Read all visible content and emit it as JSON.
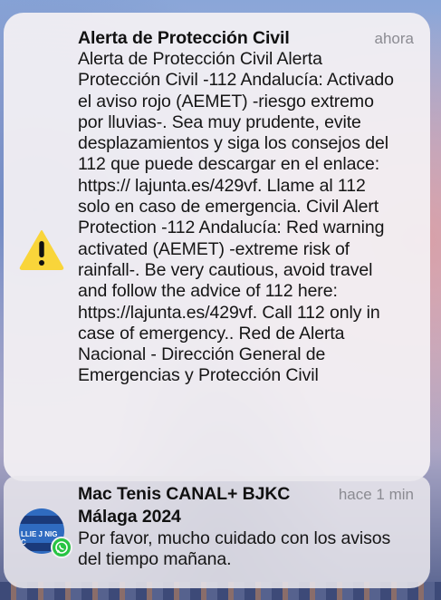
{
  "notifications": [
    {
      "title": "Alerta de Protección Civil",
      "time": "ahora",
      "icon": "warning-triangle-icon",
      "body": "Alerta de Protección Civil Alerta Protección Civil -112 Andalucía: Activado el aviso rojo (AEMET) -riesgo extremo por lluvias-. Sea muy prudente, evite desplazamientos y siga los consejos del 112 que puede descargar en el enlace: https:// lajunta.es/429vf. Llame al 112 solo en caso de emergencia. Civil Alert Protection -112 Andalucía: Red warning activated (AEMET) -extreme risk of rainfall-. Be very cautious, avoid travel and follow the advice of 112 here: https://lajunta.es/429vf. Call 112 only in case of emergency.. Red de Alerta Nacional - Dirección General de Emergencias y Protección Civil"
    },
    {
      "title": "Mac Tenis CANAL+ BJKC Málaga 2024",
      "time": "hace 1 min",
      "icon": "group-avatar-icon",
      "app_icon": "whatsapp-icon",
      "avatar_text": "LLIE J  NIG C",
      "body": "Por favor, mucho cuidado con los avisos del tiempo mañana."
    }
  ],
  "colors": {
    "warning": "#f9d53a",
    "whatsapp": "#27c443",
    "time_text": "#8b8b92"
  }
}
